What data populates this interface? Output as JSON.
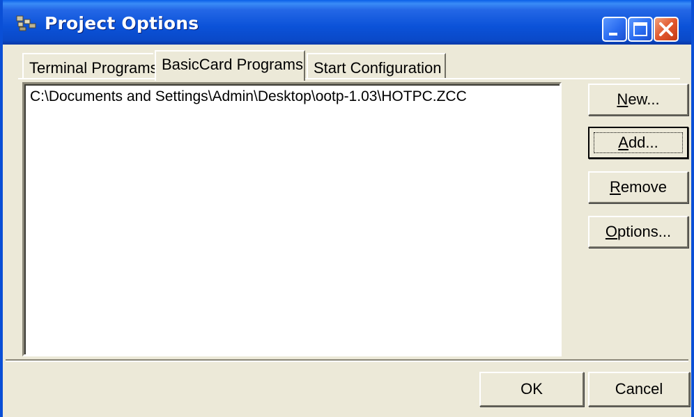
{
  "window": {
    "title": "Project Options"
  },
  "tabs": [
    {
      "label": "Terminal Programs",
      "selected": false
    },
    {
      "label": "BasicCard Programs",
      "selected": true
    },
    {
      "label": "Start Configuration",
      "selected": false
    }
  ],
  "list": {
    "items": [
      "C:\\Documents and Settings\\Admin\\Desktop\\ootp-1.03\\HOTPC.ZCC"
    ]
  },
  "buttons": {
    "new": {
      "accel": "N",
      "rest": "ew..."
    },
    "add": {
      "accel": "A",
      "rest": "dd..."
    },
    "remove": {
      "accel": "R",
      "rest": "emove"
    },
    "options": {
      "accel": "O",
      "rest": "ptions..."
    },
    "ok": "OK",
    "cancel": "Cancel"
  },
  "icons": {
    "app": "project-options-app-icon",
    "minimize": "minimize-icon",
    "maximize": "maximize-icon",
    "close": "close-icon"
  },
  "colors": {
    "titlebar": "#0b52d8",
    "close_button": "#e2582e",
    "dialog_face": "#ece9d8"
  }
}
